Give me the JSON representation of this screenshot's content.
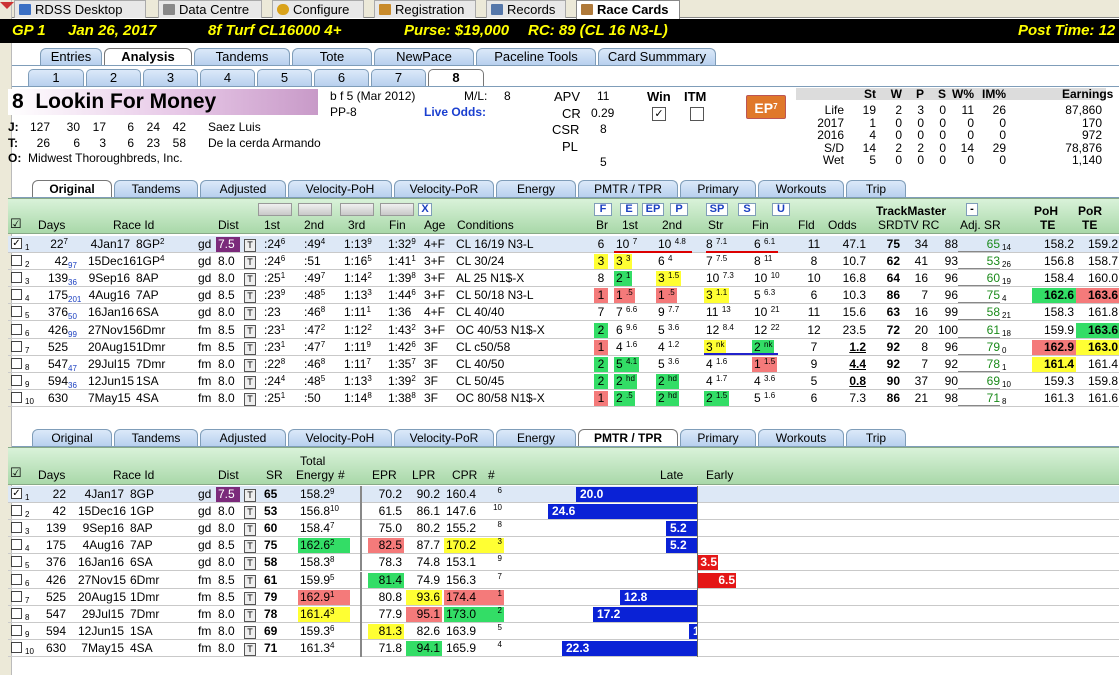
{
  "app_tabs": [
    {
      "label": "RDSS Desktop",
      "color": "#3a6fc4"
    },
    {
      "label": "Data Centre",
      "color": "#888888"
    },
    {
      "label": "Configure",
      "color": "#d9a21a"
    },
    {
      "label": "Registration",
      "color": "#c88a2a"
    },
    {
      "label": "Records",
      "color": "#5577aa"
    },
    {
      "label": "Race Cards",
      "color": "#b07a3a"
    }
  ],
  "race": {
    "gp": "GP  1",
    "date": "Jan 26, 2017",
    "surface": "8f  Turf  CL16000  4+",
    "purse": "Purse: $19,000",
    "rc": "RC: 89  (CL 16 N3-L)",
    "post": "Post Time: 12"
  },
  "main_tabs": [
    "Entries",
    "Analysis",
    "Tandems",
    "Tote",
    "NewPace",
    "Paceline Tools",
    "Card Summmary"
  ],
  "number_tabs": [
    "1",
    "2",
    "3",
    "4",
    "5",
    "6",
    "7",
    "8"
  ],
  "horse": {
    "num": "8",
    "name": "Lookin For Money",
    "bio": "b f 5  (Mar 2012)",
    "pp": "PP-8",
    "ml_label": "M/L:",
    "ml": "8",
    "live_odds": "Live Odds:",
    "jockey": {
      "label": "J:",
      "stats": [
        "127",
        "30",
        "17",
        "6",
        "24",
        "42"
      ],
      "name": "Saez Luis"
    },
    "trainer": {
      "label": "T:",
      "stats": [
        "26",
        "6",
        "3",
        "6",
        "23",
        "58"
      ],
      "name": "De la cerda Armando"
    },
    "owner": {
      "label": "O:",
      "name": "Midwest Thoroughbreds, Inc."
    }
  },
  "metrics": {
    "apv_l": "APV",
    "apv": "11",
    "cr_l": "CR",
    "cr": "0.29",
    "csr_l": "CSR",
    "csr": "8",
    "pl_l": "PL",
    "pl": "",
    "extra": "5",
    "win": "Win",
    "itm": "ITM",
    "ep": "EP",
    "ep_n": "7",
    "win_check": "✓"
  },
  "stats": {
    "headers": [
      "St",
      "W",
      "P",
      "S",
      "W%",
      "IM%",
      "Earnings"
    ],
    "rows": [
      {
        "label": "Life",
        "v": [
          "19",
          "2",
          "3",
          "0",
          "11",
          "26",
          "87,860"
        ]
      },
      {
        "label": "2017",
        "v": [
          "1",
          "0",
          "0",
          "0",
          "0",
          "0",
          "170"
        ]
      },
      {
        "label": "2016",
        "v": [
          "4",
          "0",
          "0",
          "0",
          "0",
          "0",
          "972"
        ]
      },
      {
        "label": "S/D",
        "v": [
          "14",
          "2",
          "2",
          "0",
          "14",
          "29",
          "78,876"
        ]
      },
      {
        "label": "Wet",
        "v": [
          "5",
          "0",
          "0",
          "0",
          "0",
          "0",
          "1,140"
        ]
      }
    ]
  },
  "tabs_a": [
    "Original",
    "Tandems",
    "Adjusted",
    "Velocity-PoH",
    "Velocity-PoR",
    "Energy",
    "PMTR / TPR",
    "Primary",
    "Workouts",
    "Trip"
  ],
  "tabs_b": [
    "Original",
    "Tandems",
    "Adjusted",
    "Velocity-PoH",
    "Velocity-PoR",
    "Energy",
    "PMTR / TPR",
    "Primary",
    "Workouts",
    "Trip"
  ],
  "grid1_head": {
    "check": "☑",
    "days": "Days",
    "raceid": "Race Id",
    "dist": "Dist",
    "first": "1st",
    "second": "2nd",
    "third": "3rd",
    "fin": "Fin",
    "age": "Age",
    "cond": "Conditions",
    "br": "Br",
    "c1st": "1st",
    "c2nd": "2nd",
    "str": "Str",
    "cfin": "Fin",
    "fld": "Fld",
    "odds": "Odds",
    "trackmaster": "TrackMaster",
    "srdtv": "SRDTV RC",
    "adjsr": "Adj. SR",
    "poh1": "PoH",
    "poh2": "TE",
    "por1": "PoR",
    "por2": "TE",
    "x": "X",
    "fbtns": [
      "F",
      "E",
      "EP",
      "P",
      "SP",
      "S",
      "U"
    ],
    "minus": "-"
  },
  "grid1": [
    {
      "n": "1",
      "chk": "✓",
      "days": "22",
      "dsup": "7",
      "dsub": "",
      "date": "4Jan17",
      "trk": "8GP",
      "tsup": "2",
      "cnd": "gd",
      "dist": "7.5",
      "q1": ":24",
      "q1s": "6",
      "q2": ":49",
      "q2s": "4",
      "q3": "1:13",
      "q3s": "9",
      "qf": "1:32",
      "qfs": "9",
      "age": "4+F",
      "cond": "CL 16/19 N3-L",
      "br": "6",
      "p1": "10",
      "p1s": "7",
      "p2": "10",
      "p2s": "4.8",
      "ps": "8",
      "pss": "7.1",
      "pf": "6",
      "pfs": "6.1",
      "fld": "11",
      "odds": "47.1",
      "sr": "75",
      "dtv": "34",
      "rc": "88",
      "adj": "65",
      "adjs": "14",
      "poh": "158.2",
      "por": "159.2"
    },
    {
      "n": "2",
      "chk": "",
      "days": "42",
      "dsup": "",
      "dsub": "97",
      "date": "15Dec16",
      "trk": "1GP",
      "tsup": "4",
      "cnd": "gd",
      "dist": "8.0",
      "q1": ":24",
      "q1s": "6",
      "q2": ":51",
      "q2s": "",
      "q3": "1:16",
      "q3s": "5",
      "qf": "1:41",
      "qfs": "1",
      "age": "3+F",
      "cond": "CL 30/24",
      "br": "3",
      "p1": "3",
      "p1s": "3",
      "p2": "6",
      "p2s": "4",
      "ps": "7",
      "pss": "7.5",
      "pf": "8",
      "pfs": "11",
      "fld": "8",
      "odds": "10.7",
      "sr": "62",
      "dtv": "41",
      "rc": "93",
      "adj": "53",
      "adjs": "26",
      "poh": "156.8",
      "por": "158.7"
    },
    {
      "n": "3",
      "chk": "",
      "days": "139",
      "dsup": "",
      "dsub": "36",
      "date": "9Sep16",
      "trk": "8AP",
      "tsup": "",
      "cnd": "gd",
      "dist": "8.0",
      "q1": ":25",
      "q1s": "1",
      "q2": ":49",
      "q2s": "7",
      "q3": "1:14",
      "q3s": "2",
      "qf": "1:39",
      "qfs": "8",
      "age": "3+F",
      "cond": "AL 25 N1$-X",
      "br": "8",
      "p1": "2",
      "p1s": "1",
      "p2": "3",
      "p2s": "1.5",
      "ps": "10",
      "pss": "7.3",
      "pf": "10",
      "pfs": "10",
      "fld": "10",
      "odds": "16.8",
      "sr": "64",
      "dtv": "16",
      "rc": "96",
      "adj": "60",
      "adjs": "19",
      "poh": "158.4",
      "por": "160.0"
    },
    {
      "n": "4",
      "chk": "",
      "days": "175",
      "dsup": "",
      "dsub": "201",
      "date": "4Aug16",
      "trk": "7AP",
      "tsup": "",
      "cnd": "gd",
      "dist": "8.5",
      "q1": ":23",
      "q1s": "9",
      "q2": ":48",
      "q2s": "5",
      "q3": "1:13",
      "q3s": "3",
      "qf": "1:44",
      "qfs": "6",
      "age": "3+F",
      "cond": "CL 50/18 N3-L",
      "br": "1",
      "p1": "1",
      "p1s": ".5",
      "p2": "1",
      "p2s": ".5",
      "ps": "3",
      "pss": "1.1",
      "pf": "5",
      "pfs": "6.3",
      "fld": "6",
      "odds": "10.3",
      "sr": "86",
      "dtv": "7",
      "rc": "96",
      "adj": "75",
      "adjs": "4",
      "poh": "162.6",
      "por": "163.6"
    },
    {
      "n": "5",
      "chk": "",
      "days": "376",
      "dsup": "",
      "dsub": "50",
      "date": "16Jan16",
      "trk": "6SA",
      "tsup": "",
      "cnd": "gd",
      "dist": "8.0",
      "q1": ":23",
      "q1s": "",
      "q2": ":46",
      "q2s": "8",
      "q3": "1:11",
      "q3s": "1",
      "qf": "1:36",
      "qfs": "",
      "age": "4+F",
      "cond": "CL 40/40",
      "br": "7",
      "p1": "7",
      "p1s": "6.6",
      "p2": "9",
      "p2s": "7.7",
      "ps": "11",
      "pss": "13",
      "pf": "10",
      "pfs": "21",
      "fld": "11",
      "odds": "15.6",
      "sr": "63",
      "dtv": "16",
      "rc": "99",
      "adj": "58",
      "adjs": "21",
      "poh": "158.3",
      "por": "161.8"
    },
    {
      "n": "6",
      "chk": "",
      "days": "426",
      "dsup": "",
      "dsub": "99",
      "date": "27Nov15",
      "trk": "6Dmr",
      "tsup": "",
      "cnd": "fm",
      "dist": "8.5",
      "q1": ":23",
      "q1s": "1",
      "q2": ":47",
      "q2s": "2",
      "q3": "1:12",
      "q3s": "2",
      "qf": "1:43",
      "qfs": "2",
      "age": "3+F",
      "cond": "OC 40/53 N1$-X",
      "br": "2",
      "p1": "6",
      "p1s": "9.6",
      "p2": "5",
      "p2s": "3.6",
      "ps": "12",
      "pss": "8.4",
      "pf": "12",
      "pfs": "22",
      "fld": "12",
      "odds": "23.5",
      "sr": "72",
      "dtv": "20",
      "rc": "100",
      "adj": "61",
      "adjs": "18",
      "poh": "159.9",
      "por": "163.6"
    },
    {
      "n": "7",
      "chk": "",
      "days": "525",
      "dsup": "",
      "dsub": "",
      "date": "20Aug15",
      "trk": "1Dmr",
      "tsup": "",
      "cnd": "fm",
      "dist": "8.5",
      "q1": ":23",
      "q1s": "1",
      "q2": ":47",
      "q2s": "7",
      "q3": "1:11",
      "q3s": "9",
      "qf": "1:42",
      "qfs": "6",
      "age": "3F",
      "cond": "CL c50/58",
      "br": "1",
      "p1": "4",
      "p1s": "1.6",
      "p2": "4",
      "p2s": "1.2",
      "ps": "3",
      "pss": "nk",
      "pf": "2",
      "pfs": "nk",
      "fld": "7",
      "odds": "1.2",
      "sr": "92",
      "dtv": "8",
      "rc": "96",
      "adj": "79",
      "adjs": "0",
      "poh": "162.9",
      "por": "163.0"
    },
    {
      "n": "8",
      "chk": "",
      "days": "547",
      "dsup": "",
      "dsub": "47",
      "date": "29Jul15",
      "trk": "7Dmr",
      "tsup": "",
      "cnd": "fm",
      "dist": "8.0",
      "q1": ":22",
      "q1s": "8",
      "q2": ":46",
      "q2s": "8",
      "q3": "1:11",
      "q3s": "7",
      "qf": "1:35",
      "qfs": "7",
      "age": "3F",
      "cond": "CL 40/50",
      "br": "2",
      "p1": "5",
      "p1s": "4.1",
      "p2": "5",
      "p2s": "3.6",
      "ps": "4",
      "pss": "1.6",
      "pf": "1",
      "pfs": "1.5",
      "fld": "9",
      "odds": "4.4",
      "sr": "92",
      "dtv": "7",
      "rc": "92",
      "adj": "78",
      "adjs": "1",
      "poh": "161.4",
      "por": "161.4"
    },
    {
      "n": "9",
      "chk": "",
      "days": "594",
      "dsup": "",
      "dsub": "36",
      "date": "12Jun15",
      "trk": "1SA",
      "tsup": "",
      "cnd": "fm",
      "dist": "8.0",
      "q1": ":24",
      "q1s": "4",
      "q2": ":48",
      "q2s": "5",
      "q3": "1:13",
      "q3s": "3",
      "qf": "1:39",
      "qfs": "2",
      "age": "3F",
      "cond": "CL 50/45",
      "br": "2",
      "p1": "2",
      "p1s": "hd",
      "p2": "2",
      "p2s": "hd",
      "ps": "4",
      "pss": "1.7",
      "pf": "4",
      "pfs": "3.6",
      "fld": "5",
      "odds": "0.8",
      "sr": "90",
      "dtv": "37",
      "rc": "90",
      "adj": "69",
      "adjs": "10",
      "poh": "159.3",
      "por": "159.8"
    },
    {
      "n": "10",
      "chk": "",
      "days": "630",
      "dsup": "",
      "dsub": "",
      "date": "7May15",
      "trk": "4SA",
      "tsup": "",
      "cnd": "fm",
      "dist": "8.0",
      "q1": ":25",
      "q1s": "1",
      "q2": ":50",
      "q2s": "",
      "q3": "1:14",
      "q3s": "8",
      "qf": "1:38",
      "qfs": "8",
      "age": "3F",
      "cond": "OC 80/58 N1$-X",
      "br": "1",
      "p1": "2",
      "p1s": ".5",
      "p2": "2",
      "p2s": "hd",
      "ps": "2",
      "pss": "1.5",
      "pf": "5",
      "pfs": "1.6",
      "fld": "6",
      "odds": "7.3",
      "sr": "86",
      "dtv": "21",
      "rc": "98",
      "adj": "71",
      "adjs": "8",
      "poh": "161.3",
      "por": "161.6"
    }
  ],
  "grid2_head": {
    "check": "☑",
    "days": "Days",
    "raceid": "Race Id",
    "dist": "Dist",
    "sr": "SR",
    "te1": "Total",
    "te2": "Energy",
    "hash": "#",
    "epr": "EPR",
    "lpr": "LPR",
    "cpr": "CPR",
    "late": "Late",
    "early": "Early"
  },
  "grid2": [
    {
      "n": "1",
      "chk": "✓",
      "days": "22",
      "date": "4Jan17",
      "trk": "8GP",
      "cnd": "gd",
      "dist": "7.5",
      "sr": "65",
      "te": "158.2",
      "tes": "9",
      "epr": "70.2",
      "lpr": "90.2",
      "cpr": "160.4",
      "cprs": "6",
      "bar": "20.0",
      "side": "late",
      "val": 20.0
    },
    {
      "n": "2",
      "chk": "",
      "days": "42",
      "date": "15Dec16",
      "trk": "1GP",
      "cnd": "gd",
      "dist": "8.0",
      "sr": "53",
      "te": "156.8",
      "tes": "10",
      "epr": "61.5",
      "lpr": "86.1",
      "cpr": "147.6",
      "cprs": "10",
      "bar": "24.6",
      "side": "late",
      "val": 24.6
    },
    {
      "n": "3",
      "chk": "",
      "days": "139",
      "date": "9Sep16",
      "trk": "8AP",
      "cnd": "gd",
      "dist": "8.0",
      "sr": "60",
      "te": "158.4",
      "tes": "7",
      "epr": "75.0",
      "lpr": "80.2",
      "cpr": "155.2",
      "cprs": "8",
      "bar": "5.2",
      "side": "late",
      "val": 5.2
    },
    {
      "n": "4",
      "chk": "",
      "days": "175",
      "date": "4Aug16",
      "trk": "7AP",
      "cnd": "gd",
      "dist": "8.5",
      "sr": "75",
      "te": "162.6",
      "tes": "2",
      "epr": "82.5",
      "lpr": "87.7",
      "cpr": "170.2",
      "cprs": "3",
      "bar": "5.2",
      "side": "late",
      "val": 5.2
    },
    {
      "n": "5",
      "chk": "",
      "days": "376",
      "date": "16Jan16",
      "trk": "6SA",
      "cnd": "gd",
      "dist": "8.0",
      "sr": "58",
      "te": "158.3",
      "tes": "8",
      "epr": "78.3",
      "lpr": "74.8",
      "cpr": "153.1",
      "cprs": "9",
      "bar": "3.5",
      "side": "early",
      "val": 3.5
    },
    {
      "n": "6",
      "chk": "",
      "days": "426",
      "date": "27Nov15",
      "trk": "6Dmr",
      "cnd": "fm",
      "dist": "8.5",
      "sr": "61",
      "te": "159.9",
      "tes": "5",
      "epr": "81.4",
      "lpr": "74.9",
      "cpr": "156.3",
      "cprs": "7",
      "bar": "6.5",
      "side": "early",
      "val": 6.5
    },
    {
      "n": "7",
      "chk": "",
      "days": "525",
      "date": "20Aug15",
      "trk": "1Dmr",
      "cnd": "fm",
      "dist": "8.5",
      "sr": "79",
      "te": "162.9",
      "tes": "1",
      "epr": "80.8",
      "lpr": "93.6",
      "cpr": "174.4",
      "cprs": "1",
      "bar": "12.8",
      "side": "late",
      "val": 12.8
    },
    {
      "n": "8",
      "chk": "",
      "days": "547",
      "date": "29Jul15",
      "trk": "7Dmr",
      "cnd": "fm",
      "dist": "8.0",
      "sr": "78",
      "te": "161.4",
      "tes": "3",
      "epr": "77.9",
      "lpr": "95.1",
      "cpr": "173.0",
      "cprs": "2",
      "bar": "17.2",
      "side": "late",
      "val": 17.2
    },
    {
      "n": "9",
      "chk": "",
      "days": "594",
      "date": "12Jun15",
      "trk": "1SA",
      "cnd": "fm",
      "dist": "8.0",
      "sr": "69",
      "te": "159.3",
      "tes": "6",
      "epr": "81.3",
      "lpr": "82.6",
      "cpr": "163.9",
      "cprs": "5",
      "bar": "1.3",
      "side": "late",
      "val": 1.3
    },
    {
      "n": "10",
      "chk": "",
      "days": "630",
      "date": "7May15",
      "trk": "4SA",
      "cnd": "fm",
      "dist": "8.0",
      "sr": "71",
      "te": "161.3",
      "tes": "4",
      "epr": "71.8",
      "lpr": "94.1",
      "cpr": "165.9",
      "cprs": "4",
      "bar": "22.3",
      "side": "late",
      "val": 22.3
    }
  ]
}
